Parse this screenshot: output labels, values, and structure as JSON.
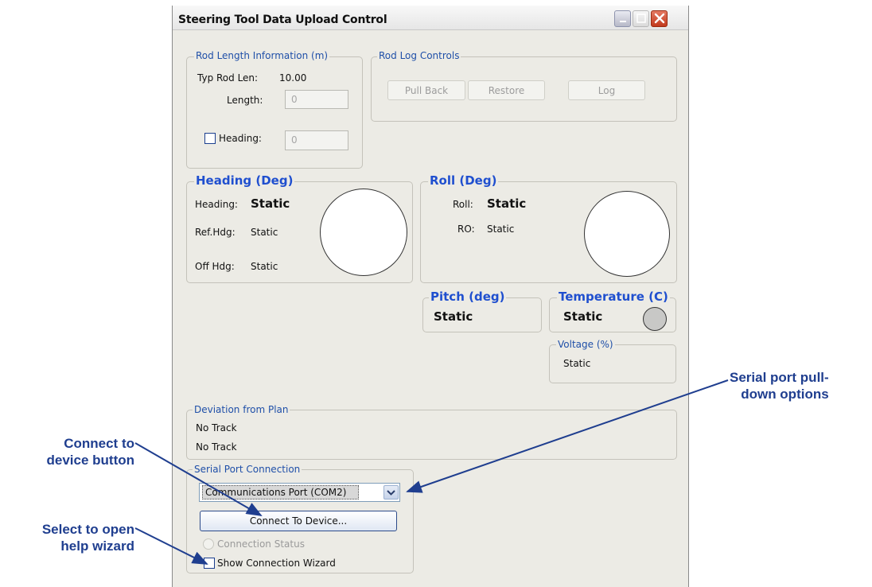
{
  "window": {
    "title": "Steering Tool Data Upload Control"
  },
  "rod_length": {
    "legend": "Rod Length Information (m)",
    "typ_label": "Typ Rod Len:",
    "typ_value": "10.00",
    "length_label": "Length:",
    "length_value": "0",
    "heading_label": "Heading:",
    "heading_value": "0"
  },
  "rod_log": {
    "legend": "Rod Log Controls",
    "pull_back": "Pull Back",
    "restore": "Restore",
    "log": "Log"
  },
  "heading": {
    "legend": "Heading (Deg)",
    "heading_label": "Heading:",
    "heading_value": "Static",
    "ref_label": "Ref.Hdg:",
    "ref_value": "Static",
    "off_label": "Off Hdg:",
    "off_value": "Static"
  },
  "roll": {
    "legend": "Roll (Deg)",
    "roll_label": "Roll:",
    "roll_value": "Static",
    "ro_label": "RO:",
    "ro_value": "Static"
  },
  "pitch": {
    "legend": "Pitch (deg)",
    "value": "Static"
  },
  "temperature": {
    "legend": "Temperature (C)",
    "value": "Static"
  },
  "voltage": {
    "legend": "Voltage (%)",
    "value": "Static"
  },
  "deviation": {
    "legend": "Deviation from Plan",
    "line1": "No Track",
    "line2": "No Track"
  },
  "serial": {
    "legend": "Serial Port Connection",
    "port_selected": "Communications Port (COM2)",
    "connect_button": "Connect To Device...",
    "status_label": "Connection Status",
    "wizard_label": "Show Connection Wizard"
  },
  "annotations": {
    "serial_port_line1": "Serial port pull-",
    "serial_port_line2": "down options",
    "connect_line1": "Connect to",
    "connect_line2": "device button",
    "wizard_line1": "Select to open",
    "wizard_line2": "help wizard"
  },
  "colors": {
    "window_bg": "#ecebe5",
    "legend_blue": "#1f4fcf",
    "annotation_blue": "#1f3e8f",
    "close_red": "#c2391d"
  }
}
